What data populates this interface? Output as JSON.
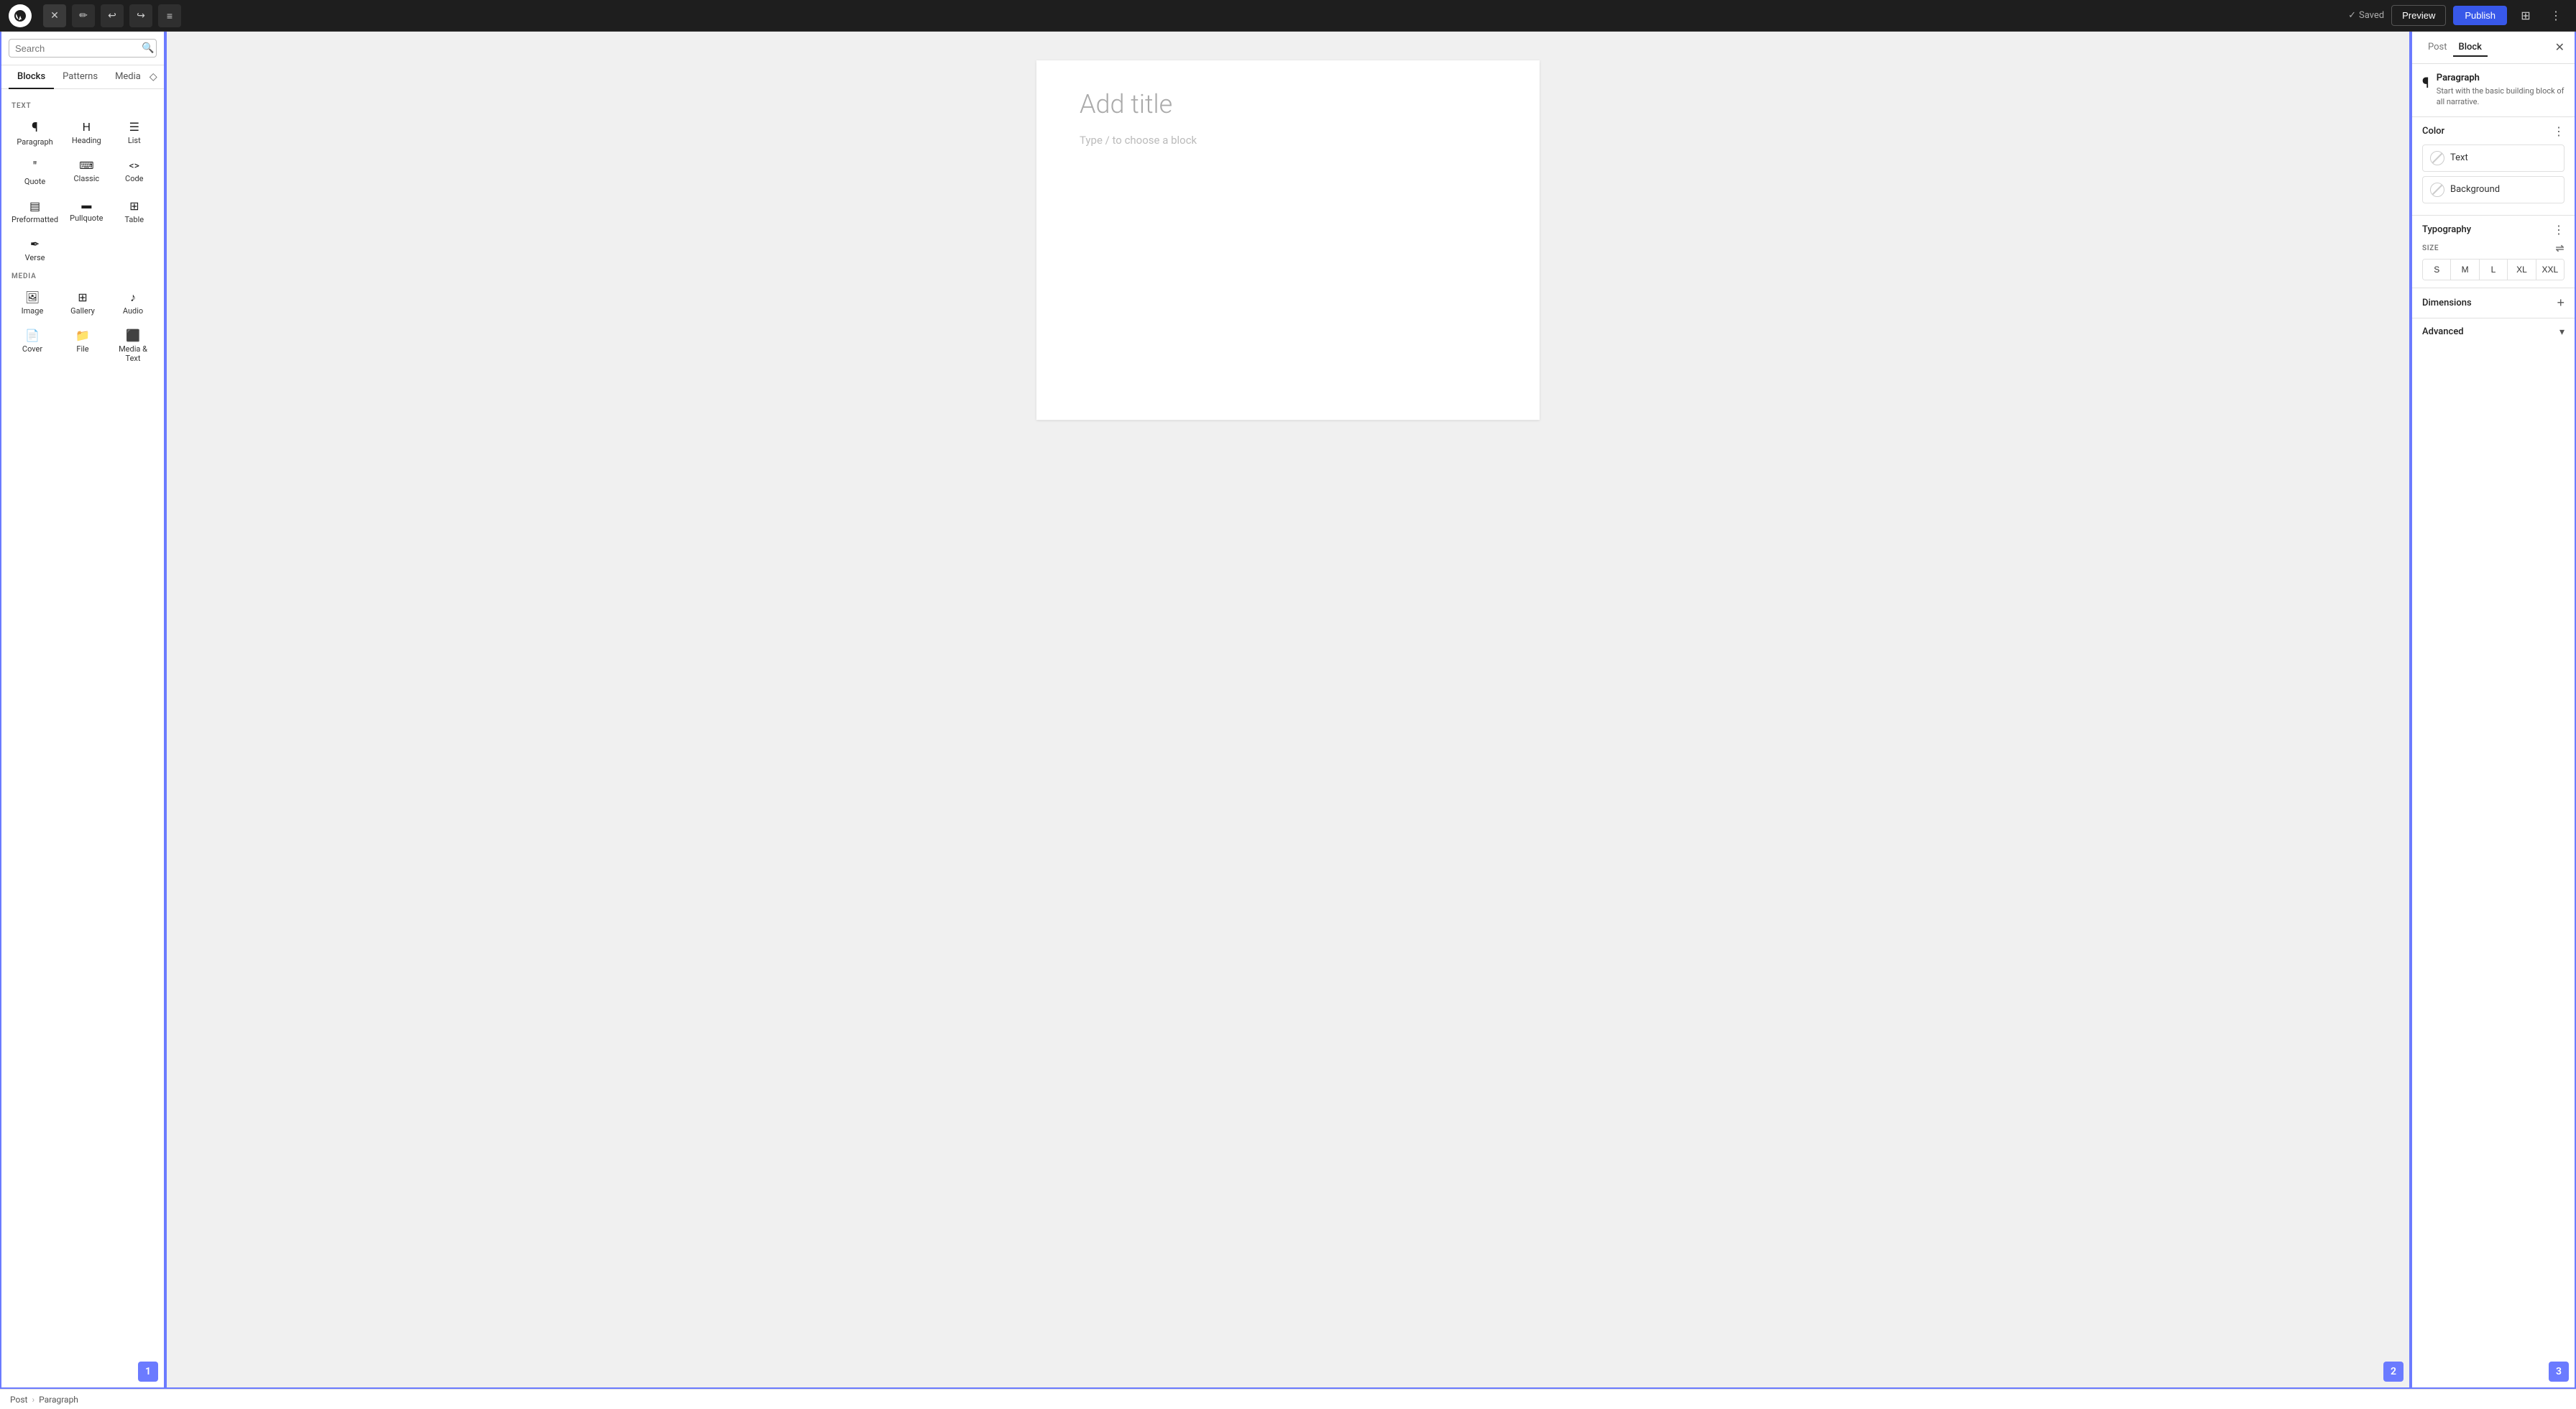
{
  "toolbar": {
    "logo_label": "WordPress",
    "close_label": "×",
    "pencil_label": "✏",
    "undo_label": "↩",
    "redo_label": "↪",
    "list_label": "≡",
    "saved_label": "Saved",
    "preview_label": "Preview",
    "publish_label": "Publish",
    "settings_label": "⊞",
    "more_label": "⋮"
  },
  "left_panel": {
    "search_placeholder": "Search",
    "tab_blocks": "Blocks",
    "tab_patterns": "Patterns",
    "tab_media": "Media",
    "section_text": "TEXT",
    "section_media": "MEDIA",
    "blocks": [
      {
        "icon": "¶",
        "label": "Paragraph"
      },
      {
        "icon": "🔖",
        "label": "Heading"
      },
      {
        "icon": "≡",
        "label": "List"
      },
      {
        "icon": "❝",
        "label": "Quote"
      },
      {
        "icon": "⌨",
        "label": "Classic"
      },
      {
        "icon": "<>",
        "label": "Code"
      },
      {
        "icon": "⊡",
        "label": "Preformatted"
      },
      {
        "icon": "⊟",
        "label": "Pullquote"
      },
      {
        "icon": "⊞",
        "label": "Table"
      },
      {
        "icon": "✒",
        "label": "Verse"
      }
    ],
    "media_blocks": [
      {
        "icon": "🖼",
        "label": "Image"
      },
      {
        "icon": "⊞",
        "label": "Gallery"
      },
      {
        "icon": "♪",
        "label": "Audio"
      },
      {
        "icon": "📄",
        "label": "Cover"
      },
      {
        "icon": "📁",
        "label": "File"
      },
      {
        "icon": "⊟",
        "label": "Media & Text"
      }
    ],
    "panel_number": "1"
  },
  "canvas": {
    "title_placeholder": "Add title",
    "content_placeholder": "Type / to choose a block",
    "panel_number": "2"
  },
  "right_panel": {
    "tab_post": "Post",
    "tab_block": "Block",
    "block_title": "Paragraph",
    "block_desc": "Start with the basic building block of all narrative.",
    "color_section_title": "Color",
    "text_label": "Text",
    "background_label": "Background",
    "typography_title": "Typography",
    "size_label": "SIZE",
    "sizes": [
      "S",
      "M",
      "L",
      "XL",
      "XXL"
    ],
    "dimensions_title": "Dimensions",
    "advanced_title": "Advanced",
    "panel_number": "3"
  },
  "status_bar": {
    "post_label": "Post",
    "separator": "›",
    "paragraph_label": "Paragraph"
  }
}
